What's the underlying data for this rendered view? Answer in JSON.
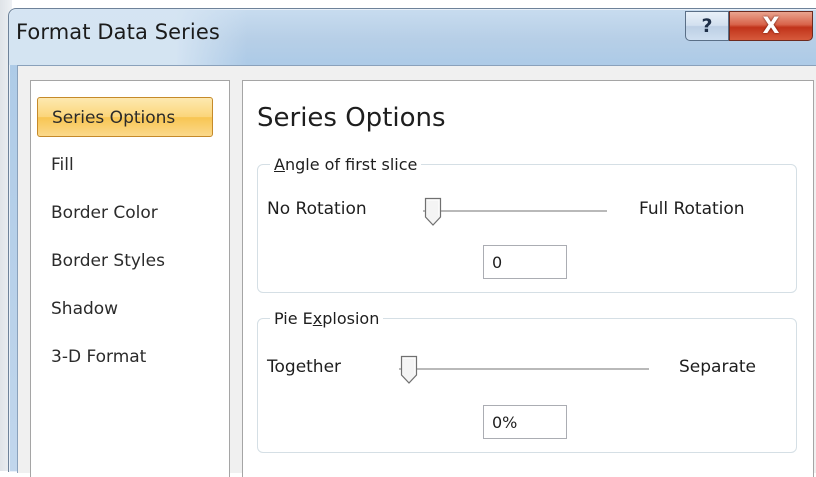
{
  "window": {
    "title": "Format Data Series",
    "help_label": "?",
    "close_label": "X"
  },
  "nav": {
    "items": [
      {
        "label": "Series Options",
        "active": true
      },
      {
        "label": "Fill",
        "active": false
      },
      {
        "label": "Border Color",
        "active": false
      },
      {
        "label": "Border Styles",
        "active": false
      },
      {
        "label": "Shadow",
        "active": false
      },
      {
        "label": "3-D Format",
        "active": false
      }
    ]
  },
  "pane": {
    "heading": "Series Options",
    "angle_group": {
      "legend_accel": "A",
      "legend_rest": "ngle of first slice",
      "left_label": "No Rotation",
      "right_label": "Full Rotation",
      "value": "0",
      "slider_fraction": 0
    },
    "explosion_group": {
      "legend_pre": "Pie E",
      "legend_accel": "x",
      "legend_rest": "plosion",
      "left_label": "Together",
      "right_label": "Separate",
      "value": "0%",
      "slider_fraction": 0
    }
  }
}
